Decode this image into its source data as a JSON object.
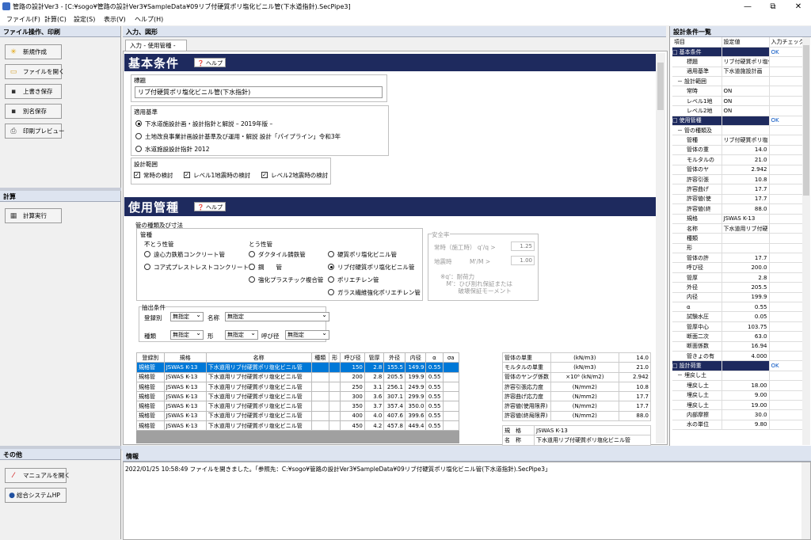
{
  "window": {
    "title": "管路の設計Ver3 - [C:¥sogo¥管路の設計Ver3¥SampleData¥09リブ付硬質ポリ塩化ビニル管(下水道指針).SecPipe3]",
    "minimize": "—",
    "maximize": "⧉",
    "close": "✕"
  },
  "menu": [
    "ファイル(F)",
    "計算(C)",
    "設定(S)",
    "表示(V)",
    "ヘルプ(H)"
  ],
  "left": {
    "file_header": "ファイル操作、印刷",
    "file_buttons": [
      "新規作成",
      "ファイルを開く",
      "上書き保存",
      "別名保存",
      "印刷プレビュー"
    ],
    "calc_header": "計算",
    "calc_button": "計算実行",
    "other_header": "その他",
    "other_buttons": [
      "マニュアルを開く",
      "総合システムHP"
    ]
  },
  "center": {
    "header": "入力、図形",
    "tab": "入力 - 使用管種 -",
    "basic": {
      "title": "基本条件",
      "help": "ヘルプ",
      "title_label": "標題",
      "title_value": "リブ付硬質ポリ塩化ビニル管(下水指針)",
      "standard_label": "適用基準",
      "standards": [
        "下水道施設計画・設計指針と解説 – 2019年版 –",
        "土地改良事業計画設計基準及び運用・解説 設計「パイプライン」令和3年",
        "水道施設設計指針 2012"
      ],
      "range_label": "設計範囲",
      "ranges": [
        "常時の検討",
        "レベル1地震時の検討",
        "レベル2地震時の検討"
      ]
    },
    "pipe": {
      "title": "使用管種",
      "help": "ヘルプ",
      "group_label": "管の種類及び寸法",
      "type_label": "管種",
      "rigid_label": "不とう性管",
      "rigid": [
        "遠心力鉄筋コンクリート管",
        "コア式プレストレストコンクリート管"
      ],
      "flexible_label": "とう性管",
      "flexible_col1": [
        "ダクタイル鋳鉄管",
        "鋼　　管",
        "強化プラスチック複合管"
      ],
      "flexible_col2": [
        "硬質ポリ塩化ビニル管",
        "リブ付硬質ポリ塩化ビニル管",
        "ポリエチレン管",
        "ガラス繊維強化ポリエチレン管"
      ],
      "safety_label": "安全率",
      "safety_normal": "常時（施工時） q'/q >",
      "safety_normal_val": "1.25",
      "safety_quake": "地震時　　　M'/M >",
      "safety_quake_val": "1.00",
      "safety_note1": "※q'：耐荷力",
      "safety_note2": "　M'：ひび割れ保証または",
      "safety_note3": "　　　破壊保証モーメント",
      "filter_label": "抽出条件",
      "reg_label": "登録別",
      "reg_val": "無指定",
      "name_label": "名称",
      "name_val": "無指定",
      "kind_label": "種類",
      "kind_val": "無指定",
      "shape_label": "形",
      "shape_val": "無指定",
      "dia_label": "呼び径",
      "dia_val": "無指定",
      "headers": [
        "登録別",
        "規格",
        "名称",
        "種類",
        "形",
        "呼び径",
        "管厚",
        "外径",
        "内径",
        "α",
        "σa"
      ],
      "rows": [
        [
          "規格管",
          "JSWAS K-13",
          "下水道用リブ付硬質ポリ塩化ビニル管",
          "",
          "",
          "150",
          "2.8",
          "155.5",
          "149.9",
          "0.55",
          ""
        ],
        [
          "規格管",
          "JSWAS K-13",
          "下水道用リブ付硬質ポリ塩化ビニル管",
          "",
          "",
          "200",
          "2.8",
          "205.5",
          "199.9",
          "0.55",
          ""
        ],
        [
          "規格管",
          "JSWAS K-13",
          "下水道用リブ付硬質ポリ塩化ビニル管",
          "",
          "",
          "250",
          "3.1",
          "256.1",
          "249.9",
          "0.55",
          ""
        ],
        [
          "規格管",
          "JSWAS K-13",
          "下水道用リブ付硬質ポリ塩化ビニル管",
          "",
          "",
          "300",
          "3.6",
          "307.1",
          "299.9",
          "0.55",
          ""
        ],
        [
          "規格管",
          "JSWAS K-13",
          "下水道用リブ付硬質ポリ塩化ビニル管",
          "",
          "",
          "350",
          "3.7",
          "357.4",
          "350.0",
          "0.55",
          ""
        ],
        [
          "規格管",
          "JSWAS K-13",
          "下水道用リブ付硬質ポリ塩化ビニル管",
          "",
          "",
          "400",
          "4.0",
          "407.6",
          "399.6",
          "0.55",
          ""
        ],
        [
          "規格管",
          "JSWAS K-13",
          "下水道用リブ付硬質ポリ塩化ビニル管",
          "",
          "",
          "450",
          "4.2",
          "457.8",
          "449.4",
          "0.55",
          ""
        ]
      ],
      "props": [
        [
          "管体の単重",
          "(kN/m3)",
          "14.0"
        ],
        [
          "モルタルの単重",
          "(kN/m3)",
          "21.0"
        ],
        [
          "管体のヤング係数",
          "×10⁶ (kN/m2)",
          "2.942"
        ],
        [
          "許容引張応力度",
          "(N/mm2)",
          "10.8"
        ],
        [
          "許容曲げ応力度",
          "(N/mm2)",
          "17.7"
        ],
        [
          "許容値(使用限界)",
          "(N/mm2)",
          "17.7"
        ],
        [
          "許容値(終局限界)",
          "(N/mm2)",
          "88.0"
        ]
      ],
      "spec_label": "規　格",
      "spec_val": "JSWAS K-13",
      "name2_label": "名　称",
      "name2_val": "下水道用リブ付硬質ポリ塩化ビニル管"
    }
  },
  "right": {
    "header": "設計条件一覧",
    "cols": [
      "項目",
      "設定値",
      "入力チェック"
    ],
    "rows": [
      [
        "□",
        "基本条件",
        "",
        "OK",
        "cat"
      ],
      [
        "",
        "標題",
        "リブ付硬質ポリ塩化",
        "",
        ""
      ],
      [
        "",
        "適用基準",
        "下水道施設計画",
        "",
        ""
      ],
      [
        "－",
        "設計範囲",
        "",
        "",
        "sub"
      ],
      [
        "",
        "常時",
        "ON",
        "",
        ""
      ],
      [
        "",
        "レベル1地",
        "ON",
        "",
        ""
      ],
      [
        "",
        "レベル2地",
        "ON",
        "",
        ""
      ],
      [
        "□",
        "使用管種",
        "",
        "OK",
        "cat"
      ],
      [
        "－",
        "管の種類及",
        "",
        "",
        "sub"
      ],
      [
        "",
        "管種",
        "リブ付硬質ポリ塩",
        "",
        ""
      ],
      [
        "",
        "管体の重",
        "14.0",
        "",
        ""
      ],
      [
        "",
        "モルタルの",
        "21.0",
        "",
        ""
      ],
      [
        "",
        "管体のヤ",
        "2.942",
        "",
        ""
      ],
      [
        "",
        "許容引張",
        "10.8",
        "",
        ""
      ],
      [
        "",
        "許容曲げ",
        "17.7",
        "",
        ""
      ],
      [
        "",
        "許容値(使",
        "17.7",
        "",
        ""
      ],
      [
        "",
        "許容値(終",
        "88.0",
        "",
        ""
      ],
      [
        "",
        "規格",
        "JSWAS K-13",
        "",
        ""
      ],
      [
        "",
        "名称",
        "下水道用リブ付硬",
        "",
        ""
      ],
      [
        "",
        "種類",
        "",
        "",
        ""
      ],
      [
        "",
        "形",
        "",
        "",
        ""
      ],
      [
        "",
        "管体の許",
        "17.7",
        "",
        ""
      ],
      [
        "",
        "呼び径",
        "200.0",
        "",
        ""
      ],
      [
        "",
        "管厚",
        "2.8",
        "",
        ""
      ],
      [
        "",
        "外径",
        "205.5",
        "",
        ""
      ],
      [
        "",
        "内径",
        "199.9",
        "",
        ""
      ],
      [
        "",
        "α",
        "0.55",
        "",
        ""
      ],
      [
        "",
        "試験水圧",
        "0.05",
        "",
        ""
      ],
      [
        "",
        "管厚中心",
        "103.75",
        "",
        ""
      ],
      [
        "",
        "断面二次",
        "63.0",
        "",
        ""
      ],
      [
        "",
        "断面係数",
        "16.94",
        "",
        ""
      ],
      [
        "",
        "管きょの有",
        "4.000",
        "",
        ""
      ],
      [
        "□",
        "設計荷重",
        "",
        "OK",
        "cat"
      ],
      [
        "－",
        "埋戻し土",
        "",
        "",
        "sub"
      ],
      [
        "",
        "埋戻し土",
        "18.00",
        "",
        ""
      ],
      [
        "",
        "埋戻し土",
        "9.00",
        "",
        ""
      ],
      [
        "",
        "埋戻し土",
        "19.00",
        "",
        ""
      ],
      [
        "",
        "内部摩擦",
        "30.0",
        "",
        ""
      ],
      [
        "",
        "水の単位",
        "9.80",
        "",
        ""
      ]
    ]
  },
  "info": {
    "header": "情報",
    "message": "2022/01/25 10:58:49 ファイルを開きました。「参照先：C:¥sogo¥管路の設計Ver3¥SampleData¥09リブ付硬質ポリ塩化ビニル管(下水道指針).SecPipe3」"
  },
  "colors": {
    "accent": "#1e2a5e",
    "selection": "#0078d7",
    "panel_header": "#dde4f0"
  }
}
